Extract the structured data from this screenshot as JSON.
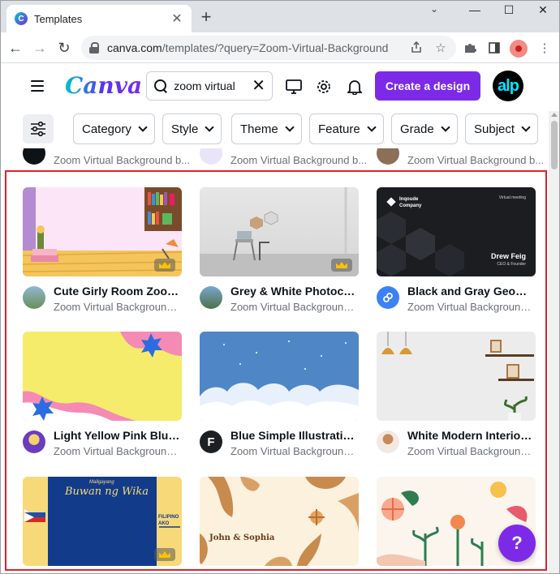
{
  "browser": {
    "tab_title": "Templates",
    "tab_favicon_letter": "C",
    "new_tab": "+",
    "url_host": "canva.com",
    "url_path": "/templates/?query=Zoom-Virtual-Background",
    "window_controls": {
      "minimize": "—",
      "maximize": "☐",
      "close": "✕",
      "tab_search": "⌄"
    }
  },
  "header": {
    "logo": "Canva",
    "search_value": "zoom virtual",
    "create_label": "Create a design",
    "avatar_initials": "alp"
  },
  "filters": [
    "Category",
    "Style",
    "Theme",
    "Feature",
    "Grade",
    "Subject"
  ],
  "partial_row": {
    "subtitle": "Zoom Virtual Background b..."
  },
  "cards": [
    {
      "title": "Cute Girly Room Zoom ...",
      "subtitle": "Zoom Virtual Background b..."
    },
    {
      "title": "Grey & White Photocen...",
      "subtitle": "Zoom Virtual Background b..."
    },
    {
      "title": "Black and Gray Geome...",
      "subtitle": "Zoom Virtual Background b..."
    },
    {
      "title": "Light Yellow Pink Blue ...",
      "subtitle": "Zoom Virtual Background b..."
    },
    {
      "title": "Blue Simple Illustratio...",
      "subtitle": "Zoom Virtual Background b..."
    },
    {
      "title": "White Modern Interior ...",
      "subtitle": "Zoom Virtual Background b..."
    }
  ],
  "thumb_text": {
    "inqoude": "Inqoude Company",
    "virtual_meeting": "Virtual meeting",
    "drew": "Drew Feig",
    "drew_role": "CEO & Founder",
    "wika_top": "Maligayang",
    "wika": "Buwan ng Wika",
    "filipino": "FILIPINO AKO",
    "couple": "John & Sophia",
    "blue_avatar": "F"
  },
  "help_label": "?"
}
